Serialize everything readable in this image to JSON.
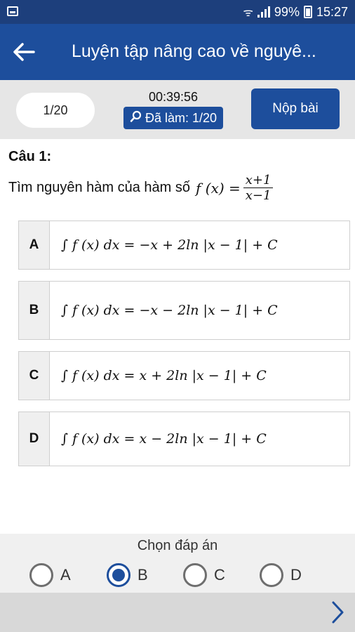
{
  "status_bar": {
    "battery": "99%",
    "time": "15:27"
  },
  "app_bar": {
    "title": "Luyện tập nâng cao về nguyê..."
  },
  "info_bar": {
    "progress": "1/20",
    "timer": "00:39:56",
    "done_label": "Đã làm: 1/20",
    "submit_label": "Nộp bài"
  },
  "question": {
    "label": "Câu 1:",
    "prompt": "Tìm nguyên hàm của hàm số",
    "formula_lhs": "f (x) =",
    "formula_num": "x+1",
    "formula_den": "x−1"
  },
  "options": [
    {
      "letter": "A",
      "text": "∫ f (x) dx = −x + 2ln |x − 1| + C"
    },
    {
      "letter": "B",
      "text": "∫ f (x) dx = −x − 2ln |x − 1| + C"
    },
    {
      "letter": "C",
      "text": "∫ f (x) dx = x + 2ln |x − 1| + C"
    },
    {
      "letter": "D",
      "text": "∫ f (x) dx = x − 2ln |x − 1| + C"
    }
  ],
  "answer_bar": {
    "title": "Chọn đáp án",
    "choices": [
      "A",
      "B",
      "C",
      "D"
    ],
    "selected": "B"
  },
  "colors": {
    "primary": "#1d4e9c",
    "status": "#1d3f7c"
  },
  "icons": {
    "back": "arrow-left-icon",
    "search": "search-icon",
    "next": "chevron-right-icon"
  }
}
